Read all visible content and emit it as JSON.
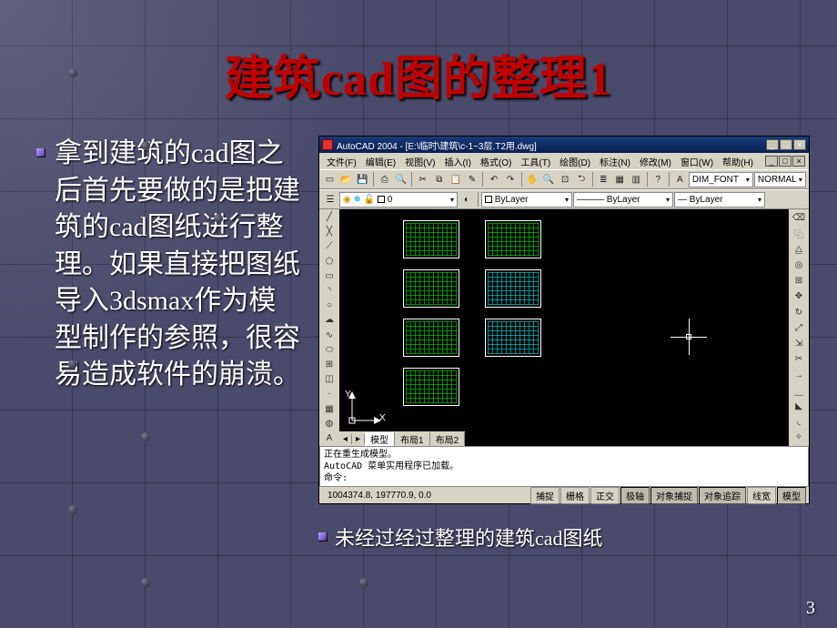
{
  "title": "建筑cad图的整理1",
  "body_text": "拿到建筑的cad图之后首先要做的是把建筑的cad图纸进行整理。如果直接把图纸导入3dsmax作为模型制作的参照，很容易造成软件的崩溃。",
  "caption": "未经过经过整理的建筑cad图纸",
  "page_number": "3",
  "cad": {
    "title": "AutoCAD 2004 - [E:\\临时\\建筑\\c-1~3层.T2用.dwg]",
    "menu": [
      "文件(F)",
      "编辑(E)",
      "视图(V)",
      "插入(I)",
      "格式(O)",
      "工具(T)",
      "绘图(D)",
      "标注(N)",
      "修改(M)",
      "窗口(W)",
      "帮助(H)"
    ],
    "layer_value": "0",
    "style_value": "DIM_FONT",
    "style2_value": "NORMAL",
    "linetype1": "ByLayer",
    "linetype2": "ByLayer",
    "linetype3": "ByLayer",
    "tabs": {
      "model": "模型",
      "layout1": "布局1",
      "layout2": "布局2"
    },
    "cmd_line1": "正在重生成模型。",
    "cmd_line2": "AutoCAD 菜单实用程序已加载。",
    "cmd_prompt": "命令:",
    "coords": "1004374.8, 197770.9, 0.0",
    "status_buttons": [
      "捕捉",
      "栅格",
      "正交",
      "极轴",
      "对象捕捉",
      "对象追踪",
      "线宽",
      "模型"
    ],
    "ucs": {
      "x": "X",
      "y": "Y"
    }
  }
}
